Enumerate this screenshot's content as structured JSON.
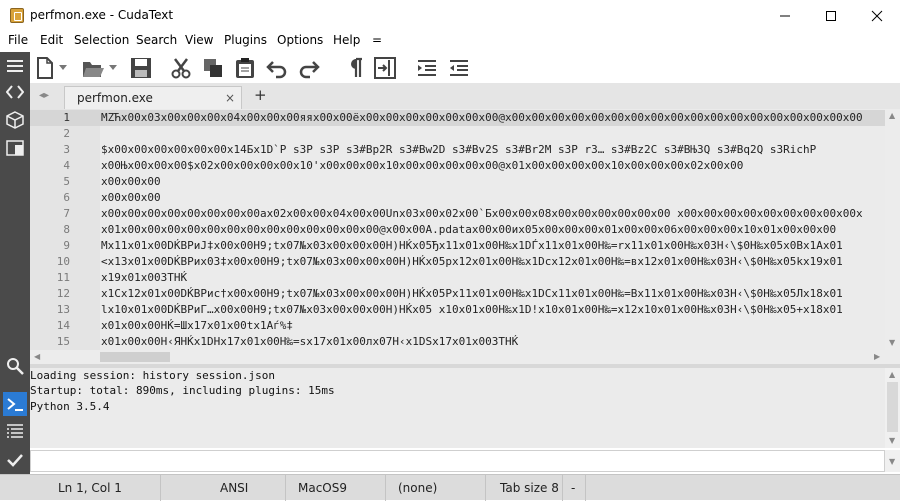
{
  "window": {
    "title": "perfmon.exe - CudaText",
    "minimize_icon": "minimize-icon",
    "maximize_icon": "maximize-icon",
    "close_icon": "close-icon"
  },
  "menu": [
    "File",
    "Edit",
    "Selection",
    "Search",
    "View",
    "Plugins",
    "Options",
    "Help",
    "="
  ],
  "toolbar": {
    "icons": [
      "new-file-icon",
      "new-dropdown-icon",
      "open-file-icon",
      "open-dropdown-icon",
      "save-icon",
      "cut-icon",
      "copy-icon",
      "paste-icon",
      "undo-icon",
      "redo-icon",
      "pilcrow-icon",
      "wrap-icon",
      "indent-icon",
      "unindent-icon"
    ]
  },
  "sidebar": {
    "icons": [
      "menu-icon",
      "code-tree-icon",
      "project-icon",
      "tabs-icon",
      "search-icon",
      "console-icon",
      "output-icon",
      "validate-icon"
    ]
  },
  "tabs": {
    "active_label": "perfmon.exe",
    "close_glyph": "×",
    "add_glyph": "+",
    "nav_glyph": "◂▸"
  },
  "editor": {
    "current_line": 1,
    "lines": [
      {
        "num": "1",
        "text": "MZЋx00x03x00x00x00x04x00x00x00яяx00x00ёx00x00x00x00x00x00x00@x00x00x00x00x00x00x00x00x00x00x00x00x00x00x00x00x00x00"
      },
      {
        "num": "2",
        "text": ""
      },
      {
        "num": "3",
        "text": "$x00x00x00x00x00x00x14Бx1D`P s3P s3P s3#Bp2R s3#Bw2D s3#Bv2S s3#Br2M s3P r3… s3#Bz2C s3#BЊ3Q s3#Bq2Q s3RichP"
      },
      {
        "num": "4",
        "text": "x00Њx00x00x00$x02x00x00x00x00x10'x00x00x00x10x00x00x00x00x00@x01x00x00x00x00x10x00x00x00x02x00x00"
      },
      {
        "num": "5",
        "text": "x00x00x00"
      },
      {
        "num": "6",
        "text": "x00x00x00"
      },
      {
        "num": "7",
        "text": "x00x00x00x00x00x00x00x00аx02x00x00x04x00x00Unx03x00x02x00`Бx00x00x08x00x00x00x00x00x00 x00x00x00x00x00x00x00x00x00x"
      },
      {
        "num": "8",
        "text": "x01x00x00x00x00x00x00x00x00x00x00x00x00x00@x00x00A.pdatax00x00иx05x00x00x00x01x00x00x06x00x00x00x10x01x00x00x00"
      },
      {
        "num": "9",
        "text": "Mx11x01x00DЌВРиJ‡x00x00H9;tx07№x03x00x00x00H)НЌx05Ђx11x01x00H‰x1DЃx11x01x00H‰=rx11x01x00H‰x03H‹\\$0H‰x05x0Bx1Ax01"
      },
      {
        "num": "10",
        "text": "<x13x01x00DЌВРиx03‡x00x00H9;tx07№x03x00x00x00H)НЌx05рx12x01x00H‰x1Dcx12x01x00H‰=вx12x01x00H‰x03H‹\\$0H‰x05kx19x01"
      },
      {
        "num": "11",
        "text": "x19x01x003ТНЌ"
      },
      {
        "num": "12",
        "text": "x1Cx12x01x00DЌВРис†x00x00H9;tx07№x03x00x00x00H)НЌx05Рx11x01x00H‰x1DCx11x01x00H‰=Вx11x01x00H‰x03H‹\\$0H‰x05Лx18x01"
      },
      {
        "num": "13",
        "text": "lx10x01x00DЌВРиГ…x00x00H9;tx07№x03x00x00x00H)НЌx05 x10x01x00H‰x1D!x10x01x00H‰=x12x10x01x00H‰x03H‹\\$0H‰x05+x18x01"
      },
      {
        "num": "14",
        "text": "x01x00x00НЌ=Шx17x01x00tx1Aѓ%‡"
      },
      {
        "num": "15",
        "text": "x01x00x00H‹ЯНЌx1DНx17x01x00H‰=sx17x01x00лx07H‹x1DSx17x01x003ТНЌ"
      }
    ]
  },
  "console": {
    "lines": [
      "Loading session: history session.json",
      "Startup: total: 890ms, including plugins: 15ms",
      "Python 3.5.4"
    ],
    "input_value": ""
  },
  "statusbar": {
    "position": "Ln 1, Col 1",
    "encoding": "ANSI",
    "line_ends": "MacOS9",
    "lexer": "(none)",
    "tab_size": "Tab size 8",
    "extra": "-"
  }
}
